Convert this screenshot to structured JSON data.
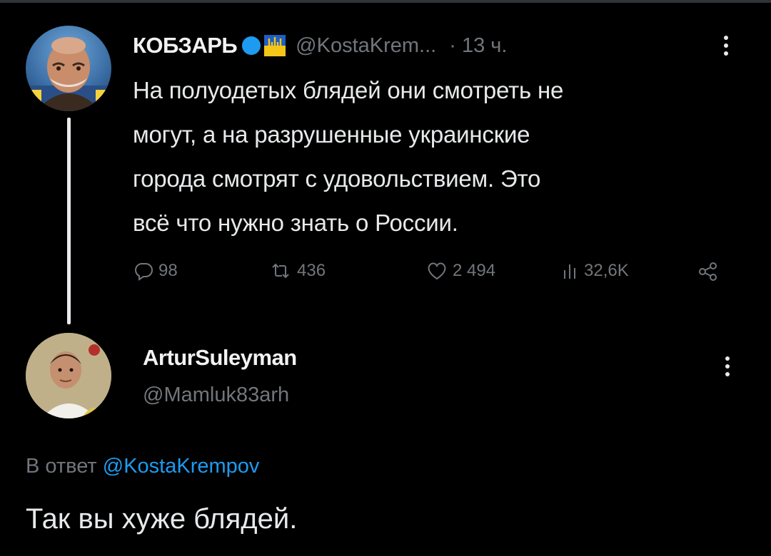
{
  "parent_tweet": {
    "author_name": "КОБЗАРЬ",
    "handle": "@KostaKrem...",
    "time": "· 13 ч.",
    "text_lines": [
      "На полуодетых блядей они смотреть не",
      "могут, а на разрушенные украинские",
      "города смотрят с удовольствием. Это",
      "всё что нужно знать о России."
    ],
    "stats": {
      "replies": "98",
      "retweets": "436",
      "likes": "2 494",
      "views": "32,6K"
    }
  },
  "reply_tweet": {
    "author_name": "ArturSuleyman",
    "handle": "@Mamluk83arh",
    "reply_prefix": "В ответ",
    "reply_mention": "@KostaKrempov",
    "text": "Так вы хуже блядей."
  },
  "icons": {
    "verified": "verified-badge-icon",
    "trident": "trident-icon",
    "reply": "reply-icon",
    "retweet": "retweet-icon",
    "like": "heart-icon",
    "views": "views-chart-icon",
    "share": "share-icon",
    "more": "more-vertical-icon"
  },
  "colors": {
    "background": "#000000",
    "text": "#e7e9ea",
    "muted": "#71767b",
    "accent": "#1d9bf0"
  }
}
